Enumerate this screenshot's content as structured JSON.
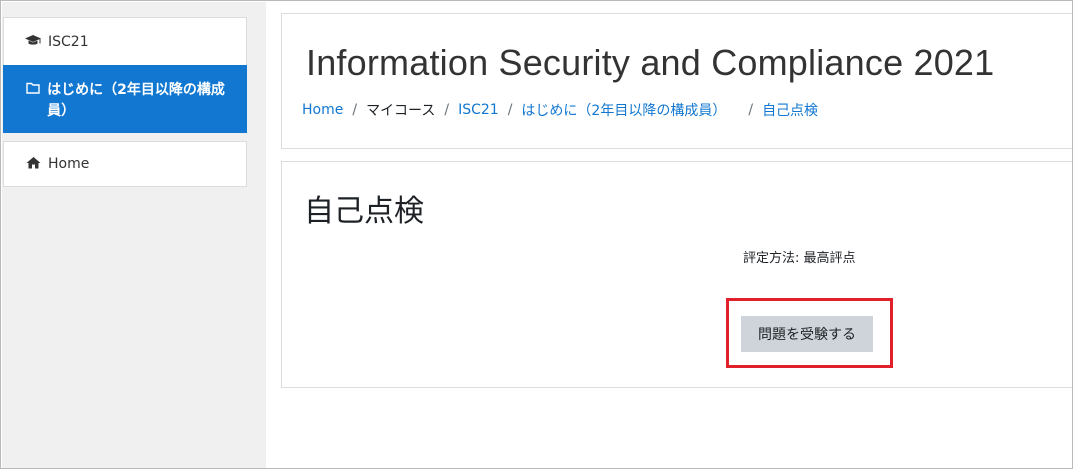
{
  "sidebar": {
    "course_label": "ISC21",
    "active_section_label": "はじめに（2年目以降の構成員）",
    "home_label": "Home"
  },
  "header": {
    "title": "Information Security and Compliance 2021",
    "breadcrumb": [
      "Home",
      "マイコース",
      "ISC21",
      "はじめに（2年目以降の構成員）",
      "自己点検"
    ]
  },
  "quiz": {
    "title": "自己点検",
    "grading_method": "評定方法: 最高評点",
    "attempt_button_label": "問題を受験する"
  },
  "colors": {
    "accent": "#1177d1",
    "highlight_border": "#e0202a",
    "button_bg": "#ced4da",
    "sidebar_bg": "#f0f0f0"
  }
}
